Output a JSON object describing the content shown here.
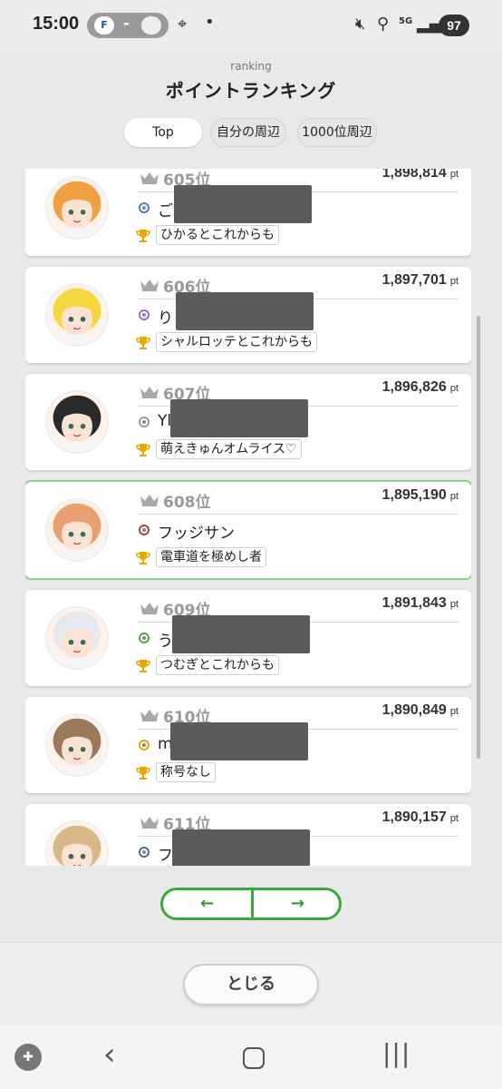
{
  "status_bar": {
    "time": "15:00",
    "pill_left": "F",
    "pill_mid": "-",
    "battery": "97",
    "network": "5G"
  },
  "header": {
    "subtitle": "ranking",
    "title": "ポイントランキング"
  },
  "tabs": [
    {
      "label": "Top",
      "active": true
    },
    {
      "label": "自分の周辺",
      "active": false
    },
    {
      "label": "1000位周辺",
      "active": false
    }
  ],
  "entries": [
    {
      "rank": "605位",
      "points": "1,898,814",
      "unit": "pt",
      "name": "ご",
      "title": "ひかるとこれからも",
      "badge_color": "#4a7fc0",
      "avatar_hair": "#f0a040",
      "redacted": true
    },
    {
      "rank": "606位",
      "points": "1,897,701",
      "unit": "pt",
      "name": "り",
      "title": "シャルロッテとこれからも",
      "badge_color": "#9a6ad0",
      "avatar_hair": "#f5d840",
      "redacted": true
    },
    {
      "rank": "607位",
      "points": "1,896,826",
      "unit": "pt",
      "name": "Yl",
      "title": "萌えきゅんオムライス♡",
      "badge_color": "#9a9a9a",
      "avatar_hair": "#2a2a2a",
      "redacted": true
    },
    {
      "rank": "608位",
      "points": "1,895,190",
      "unit": "pt",
      "name": "フッジサン",
      "title": "電車道を極めし者",
      "badge_color": "#b04040",
      "avatar_hair": "#e8a070",
      "redacted": false
    },
    {
      "rank": "609位",
      "points": "1,891,843",
      "unit": "pt",
      "name": "う",
      "title": "つむぎとこれからも",
      "badge_color": "#5aa050",
      "avatar_hair": "#e8e8ef",
      "redacted": true
    },
    {
      "rank": "610位",
      "points": "1,890,849",
      "unit": "pt",
      "name": "m",
      "title": "称号なし",
      "badge_color": "#e0a800",
      "avatar_hair": "#9a7a5a",
      "redacted": true
    },
    {
      "rank": "611位",
      "points": "1,890,157",
      "unit": "pt",
      "name": "フ",
      "title": "",
      "badge_color": "#4a6aa0",
      "avatar_hair": "#d8b888",
      "redacted": true
    }
  ],
  "pager": {
    "prev": "←",
    "next": "→"
  },
  "close_label": "とじる",
  "colors": {
    "accent_green": "#3aa83a",
    "highlight_border": "#8fd18a",
    "redaction": "#5b5b5b"
  }
}
